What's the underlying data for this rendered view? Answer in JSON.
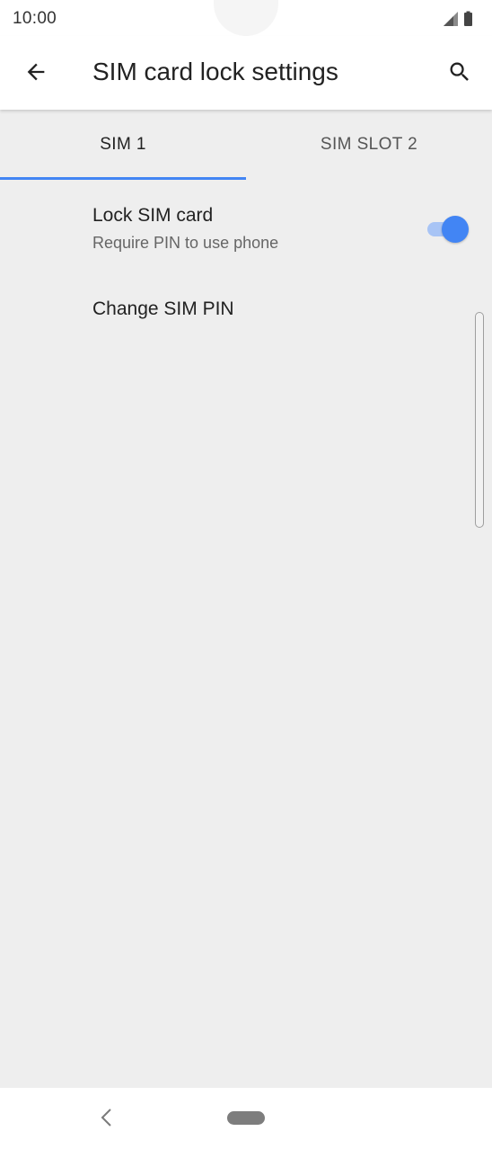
{
  "status_bar": {
    "time": "10:00",
    "icons": [
      "signal-icon",
      "battery-icon"
    ]
  },
  "app_bar": {
    "title": "SIM card lock settings",
    "back_icon": "arrow-back-icon",
    "search_icon": "search-icon"
  },
  "tabs": [
    {
      "label": "SIM 1",
      "selected": true
    },
    {
      "label": "SIM SLOT 2",
      "selected": false
    }
  ],
  "preferences": {
    "lock_sim": {
      "title": "Lock SIM card",
      "summary": "Require PIN to use phone",
      "enabled": true
    },
    "change_pin": {
      "title": "Change SIM PIN"
    }
  },
  "colors": {
    "accent": "#4285f4",
    "background": "#eeeeee"
  },
  "nav_bar": {
    "icons": [
      "nav-back-icon",
      "home-pill-icon"
    ]
  }
}
